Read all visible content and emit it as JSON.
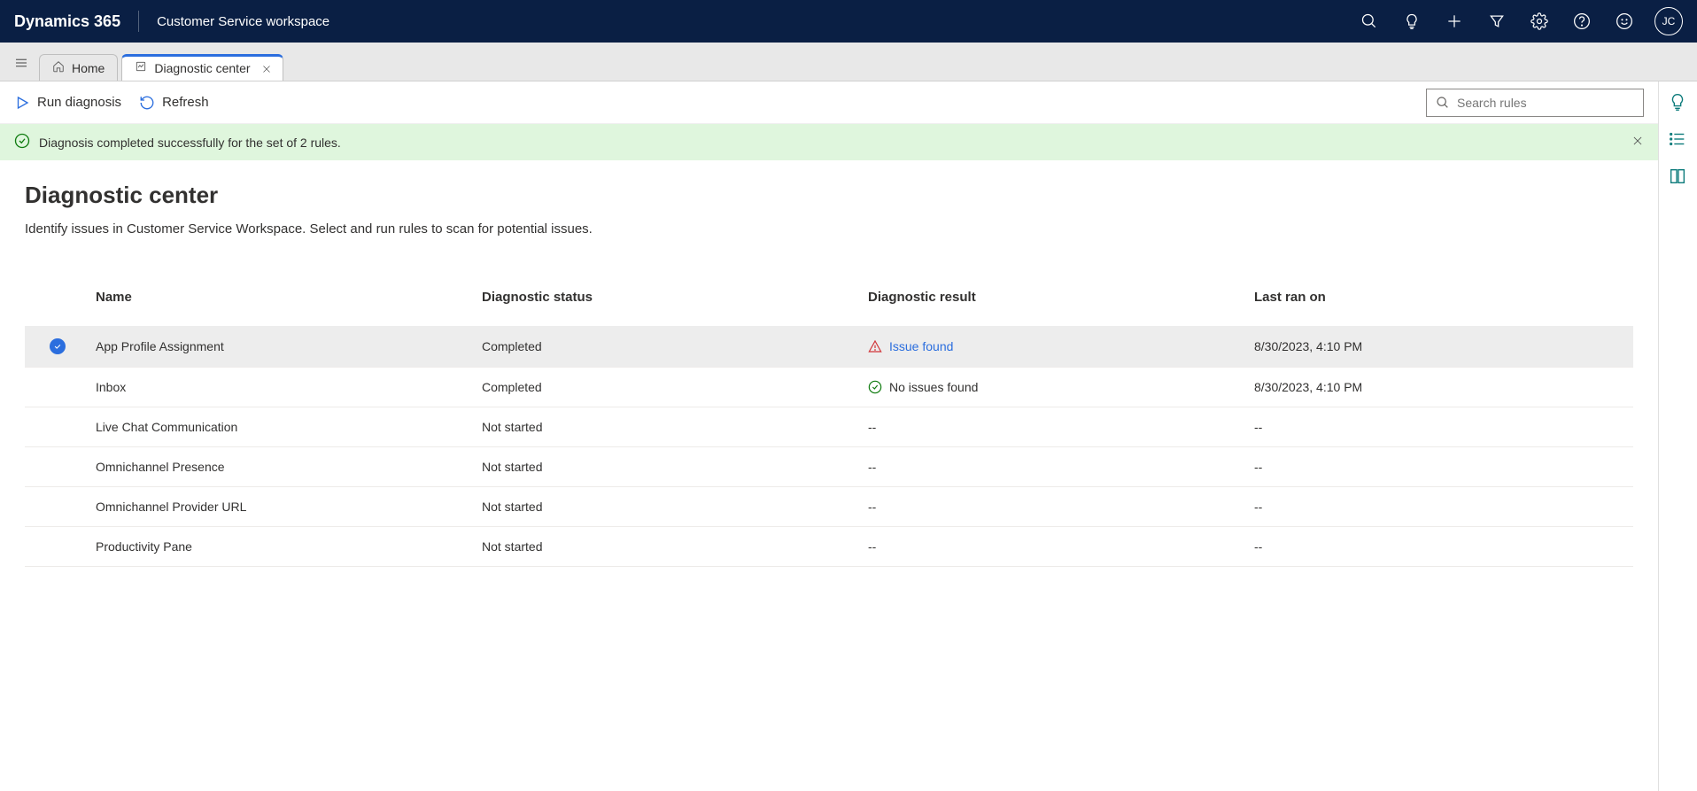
{
  "topbar": {
    "brand": "Dynamics 365",
    "workspace": "Customer Service workspace",
    "avatar": "JC"
  },
  "tabs": {
    "home": "Home",
    "active": "Diagnostic center"
  },
  "commands": {
    "run": "Run diagnosis",
    "refresh": "Refresh"
  },
  "search": {
    "placeholder": "Search rules"
  },
  "notification": "Diagnosis completed successfully for the set of 2 rules.",
  "page": {
    "title": "Diagnostic center",
    "description": "Identify issues in Customer Service Workspace. Select and run rules to scan for potential issues."
  },
  "table": {
    "headers": {
      "name": "Name",
      "status": "Diagnostic status",
      "result": "Diagnostic result",
      "lastRan": "Last ran on"
    },
    "rows": [
      {
        "selected": true,
        "name": "App Profile Assignment",
        "status": "Completed",
        "resultType": "issue",
        "resultText": "Issue found",
        "lastRan": "8/30/2023, 4:10 PM"
      },
      {
        "selected": false,
        "name": "Inbox",
        "status": "Completed",
        "resultType": "ok",
        "resultText": "No issues found",
        "lastRan": "8/30/2023, 4:10 PM"
      },
      {
        "selected": false,
        "name": "Live Chat Communication",
        "status": "Not started",
        "resultType": "none",
        "resultText": "--",
        "lastRan": "--"
      },
      {
        "selected": false,
        "name": "Omnichannel Presence",
        "status": "Not started",
        "resultType": "none",
        "resultText": "--",
        "lastRan": "--"
      },
      {
        "selected": false,
        "name": "Omnichannel Provider URL",
        "status": "Not started",
        "resultType": "none",
        "resultText": "--",
        "lastRan": "--"
      },
      {
        "selected": false,
        "name": "Productivity Pane",
        "status": "Not started",
        "resultType": "none",
        "resultText": "--",
        "lastRan": "--"
      }
    ]
  }
}
